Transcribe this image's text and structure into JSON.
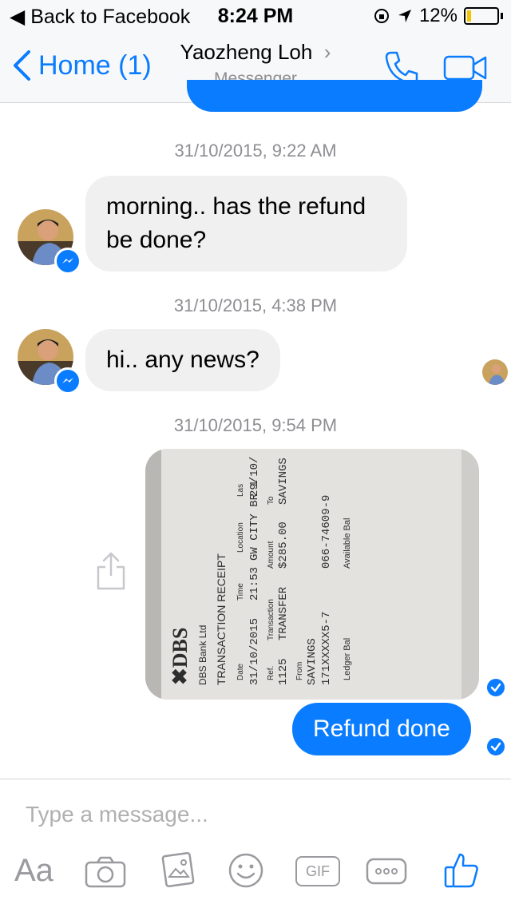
{
  "status": {
    "back_label": "Back to Facebook",
    "time": "8:24 PM",
    "battery": "12%"
  },
  "nav": {
    "back_label": "Home (1)",
    "contact_name": "Yaozheng Loh",
    "subtitle": "Messenger"
  },
  "messages": [
    {
      "timestamp": "31/10/2015, 9:22 AM",
      "text": "morning.. has the refund be done?"
    },
    {
      "timestamp": "31/10/2015, 4:38 PM",
      "text": "hi.. any news?"
    },
    {
      "timestamp": "31/10/2015, 9:54 PM",
      "text": "Refund done"
    }
  ],
  "receipt": {
    "bank": "DBS Bank Ltd",
    "title": "TRANSACTION RECEIPT",
    "date_label": "Date",
    "time_label": "Time",
    "location_label": "Location",
    "date": "31/10/2015",
    "time": "21:53",
    "location": "GW CITY BR 1",
    "last_label": "Las",
    "last_value": "29/10/",
    "ref_label": "Ref.",
    "transaction_label": "Transaction",
    "amount_label": "Amount",
    "to_label": "To",
    "ref": "1125",
    "transaction": "TRANSFER",
    "amount": "$285.00",
    "to_account": "SAVINGS",
    "from_label": "From",
    "from": "SAVINGS",
    "from_acct": "171XXXXX5-7",
    "to_acct": "066-74609-9",
    "ledger_label": "Ledger Bal",
    "avail_label": "Available Bal"
  },
  "composer": {
    "placeholder": "Type a message...",
    "aa_label": "Aa",
    "gif_label": "GIF"
  },
  "colors": {
    "accent": "#0a7cff",
    "bubble_in": "#f0f0f0"
  }
}
